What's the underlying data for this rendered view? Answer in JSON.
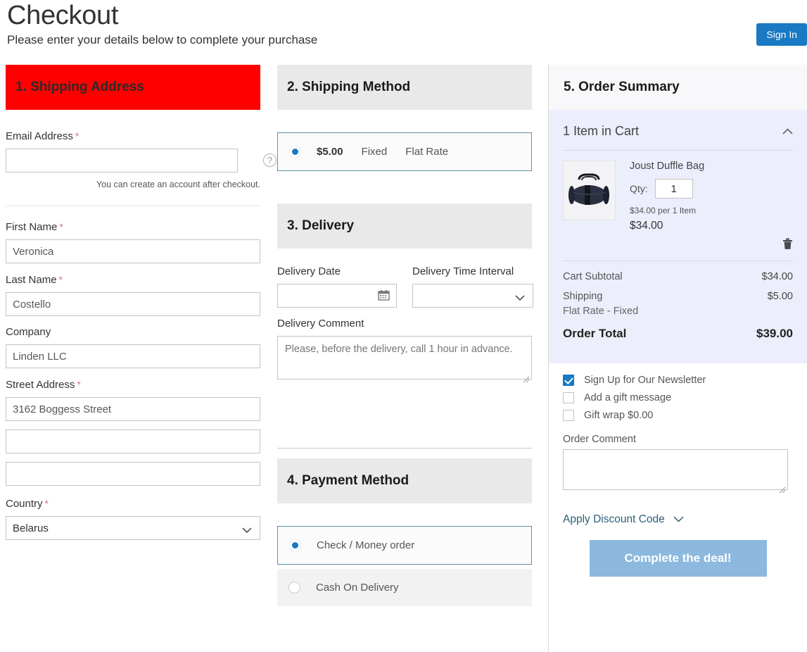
{
  "header": {
    "title": "Checkout",
    "subtitle": "Please enter your details below to complete your purchase",
    "signin_label": "Sign In",
    "signin_color": "#1979c3"
  },
  "shipping_address": {
    "heading": "1. Shipping Address",
    "heading_bg": "#ff0000",
    "email": {
      "label": "Email Address",
      "required": "*",
      "value": "",
      "help_icon": "question-mark-icon",
      "hint": "You can create an account after checkout."
    },
    "first_name": {
      "label": "First Name",
      "required": "*",
      "value": "Veronica"
    },
    "last_name": {
      "label": "Last Name",
      "required": "*",
      "value": "Costello"
    },
    "company": {
      "label": "Company",
      "required": "",
      "value": "Linden LLC"
    },
    "street": {
      "label": "Street Address",
      "required": "*",
      "line1": "3162 Boggess Street",
      "line2": "",
      "line3": ""
    },
    "country": {
      "label": "Country",
      "required": "*",
      "value": "Belarus"
    }
  },
  "shipping_method": {
    "heading": "2. Shipping Method",
    "options": [
      {
        "price": "$5.00",
        "method": "Fixed",
        "carrier": "Flat Rate",
        "selected": true
      }
    ]
  },
  "delivery": {
    "heading": "3. Delivery",
    "date": {
      "label": "Delivery Date",
      "value": "",
      "icon": "calendar-icon"
    },
    "time_interval": {
      "label": "Delivery Time Interval",
      "value": ""
    },
    "comment": {
      "label": "Delivery Comment",
      "value": "",
      "placeholder": "Please, before the delivery, call 1 hour in advance."
    }
  },
  "payment_method": {
    "heading": "4. Payment Method",
    "options": [
      {
        "label": "Check / Money order",
        "selected": true
      },
      {
        "label": "Cash On Delivery",
        "selected": false
      }
    ]
  },
  "order_summary": {
    "heading": "5. Order Summary",
    "cart_title": "1 Item in Cart",
    "collapse_icon": "chevron-up-icon",
    "item": {
      "name": "Joust Duffle Bag",
      "qty_label": "Qty:",
      "qty": "1",
      "unit_price": "$34.00 per 1 Item",
      "line_total": "$34.00",
      "thumb": "duffle-bag-image",
      "remove_icon": "trash-icon"
    },
    "totals": [
      {
        "label": "Cart Subtotal",
        "value": "$34.00",
        "sub": ""
      },
      {
        "label": "Shipping",
        "value": "$5.00",
        "sub": "Flat Rate - Fixed"
      }
    ],
    "grand_total": {
      "label": "Order Total",
      "value": "$39.00"
    },
    "panel_bg": "#eceefb"
  },
  "extras": {
    "checkboxes": [
      {
        "label": "Sign Up for Our Newsletter",
        "checked": true
      },
      {
        "label": "Add a gift message",
        "checked": false
      },
      {
        "label": "Gift wrap $0.00",
        "checked": false
      }
    ],
    "order_comment": {
      "label": "Order Comment",
      "value": ""
    },
    "discount": {
      "label": "Apply Discount Code",
      "icon": "chevron-down-icon"
    },
    "cta": {
      "label": "Complete the deal!",
      "color": "#8cb9dd"
    }
  }
}
